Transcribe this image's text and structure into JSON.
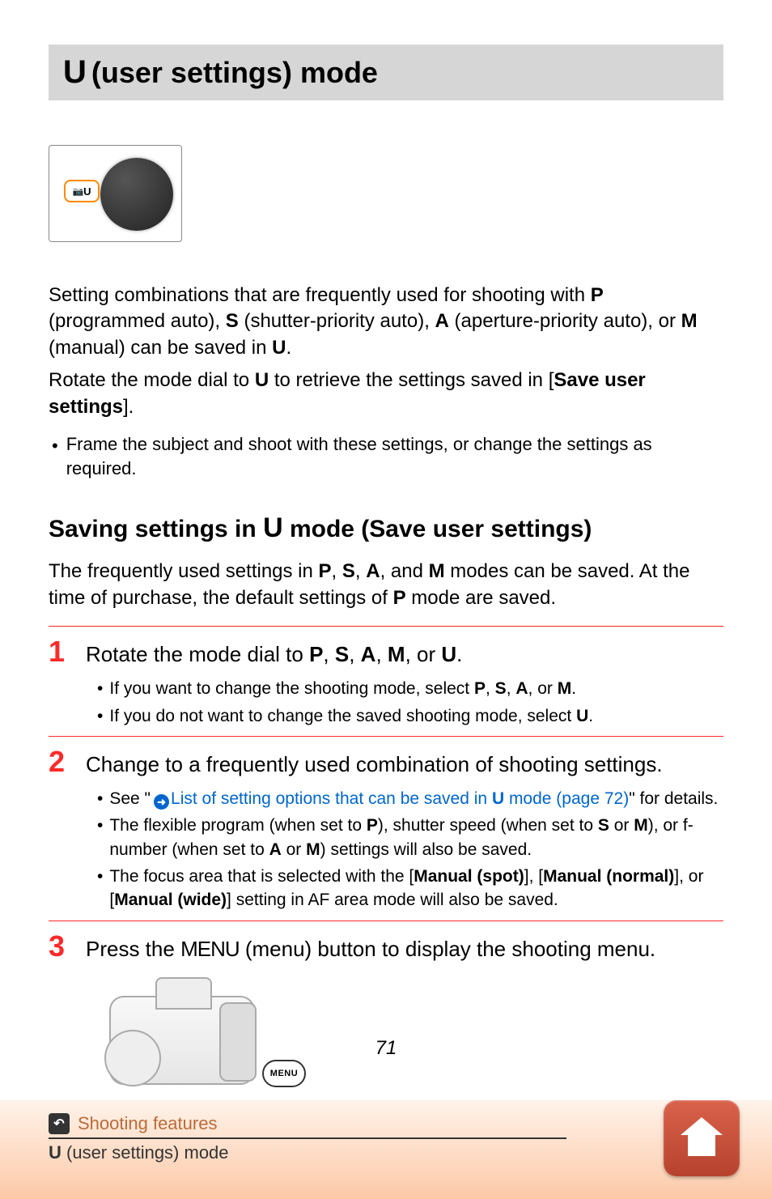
{
  "heading": {
    "mode_glyph": "U",
    "title_rest": "(user settings) mode"
  },
  "dial_image_label": "U",
  "intro_paragraph": {
    "text_a": "Setting combinations that are frequently used for shooting with ",
    "g1": "P",
    "text_b": " (programmed auto), ",
    "g2": "S",
    "text_c": " (shutter-priority auto), ",
    "g3": "A",
    "text_d": " (aperture-priority auto), or ",
    "g4": "M",
    "text_e": " (manual) can be saved in ",
    "g5": "U",
    "text_f": "."
  },
  "intro_paragraph2": {
    "text_a": "Rotate the mode dial to ",
    "g1": "U",
    "text_b": " to retrieve the settings saved in [",
    "bold": "Save user settings",
    "text_c": "]."
  },
  "intro_bullet": "Frame the subject and shoot with these settings, or change the settings as required.",
  "subheading": {
    "text_a": "Saving settings in ",
    "glyph": "U",
    "text_b": " mode (Save user settings)"
  },
  "sub_intro": {
    "text_a": "The frequently used settings in ",
    "g1": "P",
    "g2": "S",
    "g3": "A",
    "g4": "M",
    "text_b": " modes can be saved. At the time of purchase, the default settings of ",
    "g5": "P",
    "text_c": " mode are saved."
  },
  "steps": {
    "s1": {
      "num": "1",
      "title_a": "Rotate the mode dial to ",
      "g1": "P",
      "g2": "S",
      "g3": "A",
      "g4": "M",
      "g5": "U",
      "title_b": ".",
      "bullets": {
        "b1_a": "If you want to change the shooting mode, select ",
        "b1_g1": "P",
        "b1_g2": "S",
        "b1_g3": "A",
        "b1_g4": "M",
        "b1_b": ".",
        "b2_a": "If you do not want to change the saved shooting mode, select ",
        "b2_g1": "U",
        "b2_b": "."
      }
    },
    "s2": {
      "num": "2",
      "title": "Change to a frequently used combination of shooting settings.",
      "bullets": {
        "b1_a": "See \"",
        "b1_link": "List of setting options that can be saved in ",
        "b1_glyph": "U",
        "b1_link_b": " mode (page 72)",
        "b1_b": "\" for details.",
        "b2_a": "The flexible program (when set to ",
        "b2_g1": "P",
        "b2_b": "), shutter speed (when set to ",
        "b2_g2": "S",
        "b2_c": " or ",
        "b2_g3": "M",
        "b2_d": "), or f-number (when set to ",
        "b2_g4": "A",
        "b2_e": " or ",
        "b2_g5": "M",
        "b2_f": ") settings will also be saved.",
        "b3_a": "The focus area that is selected with the [",
        "b3_bold1": "Manual (spot)",
        "b3_b": "], [",
        "b3_bold2": "Manual (normal)",
        "b3_c": "], or [",
        "b3_bold3": "Manual (wide)",
        "b3_d": "] setting in AF area mode will also be saved."
      }
    },
    "s3": {
      "num": "3",
      "title_a": "Press the ",
      "menu_word": "MENU",
      "title_b": " (menu) button to display the shooting menu."
    }
  },
  "camera_menu_label": "MENU",
  "page_number": "71",
  "footer": {
    "chapter": "Shooting features",
    "section_glyph": "U",
    "section_rest": " (user settings) mode"
  }
}
